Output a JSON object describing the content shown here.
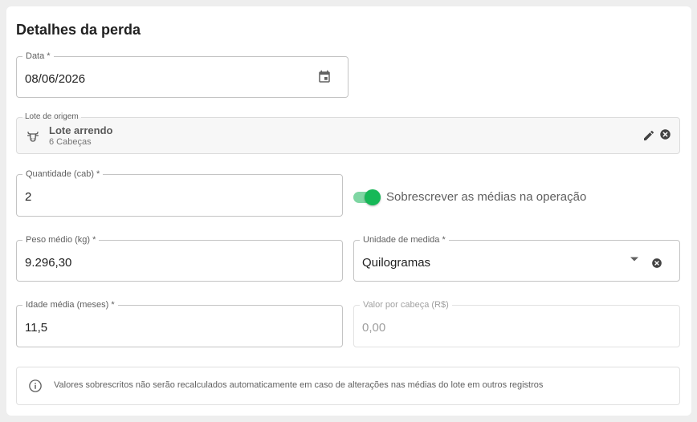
{
  "section": {
    "title": "Detalhes da perda"
  },
  "data_field": {
    "label": "Data *",
    "value": "08/06/2026",
    "icon": "calendar-icon"
  },
  "lote_field": {
    "label": "Lote de origem",
    "name": "Lote arrendo",
    "subtitle": "6 Cabeças",
    "icon": "cow-icon"
  },
  "quantidade_field": {
    "label": "Quantidade (cab) *",
    "value": "2"
  },
  "override_toggle": {
    "label": "Sobrescrever as médias na operação",
    "checked": true,
    "color": "#16b857"
  },
  "peso_field": {
    "label": "Peso médio (kg) *",
    "value": "9.296,30"
  },
  "unidade_field": {
    "label": "Unidade de medida *",
    "value": "Quilogramas"
  },
  "idade_field": {
    "label": "Idade média (meses) *",
    "value": "11,5"
  },
  "valor_field": {
    "label": "Valor por cabeça (R$)",
    "value": "0,00",
    "disabled": true
  },
  "info_notice": {
    "text": "Valores sobrescritos não serão recalculados automaticamente em caso de alterações nas médias do lote em outros registros",
    "icon": "info-icon"
  }
}
